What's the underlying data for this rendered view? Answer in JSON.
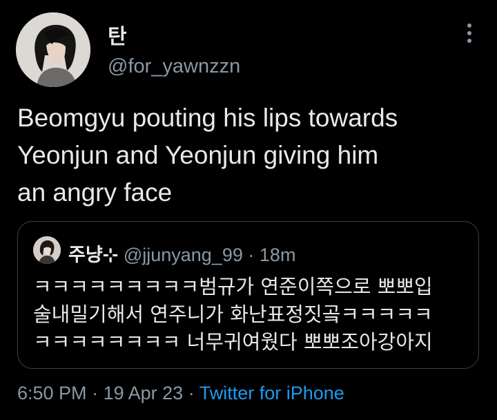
{
  "author": {
    "display_name": "탄",
    "handle": "@for_yawnzzn"
  },
  "tweet": {
    "text": "Beomgyu pouting his lips towards\nYeonjun and Yeonjun giving him\nan angry face"
  },
  "quoted_tweet": {
    "display_name": "주냥",
    "name_suffix": "⊹",
    "handle": "@jjunyang_99",
    "separator": "·",
    "time": "18m",
    "text": "ㅋㅋㅋㅋㅋㅋㅋㅋㅋ범규가 연준이쪽으로 뽀뽀입\n술내밀기해서 연주니가 화난표정짓곸ㅋㅋㅋㅋㅋ\nㅋㅋㅋㅋㅋㅋㅋㅋ 너무귀여웠다 뽀뽀조아강아지"
  },
  "meta": {
    "time": "6:50 PM",
    "date": "19 Apr 23",
    "separator": "·",
    "source": "Twitter for iPhone"
  },
  "icons": {
    "more": "more-vertical-icon"
  },
  "colors": {
    "background": "#000000",
    "primary_text": "#e7e9ea",
    "secondary_text": "#8b98a5",
    "link": "#1d9bf0",
    "border": "#3c4043"
  }
}
